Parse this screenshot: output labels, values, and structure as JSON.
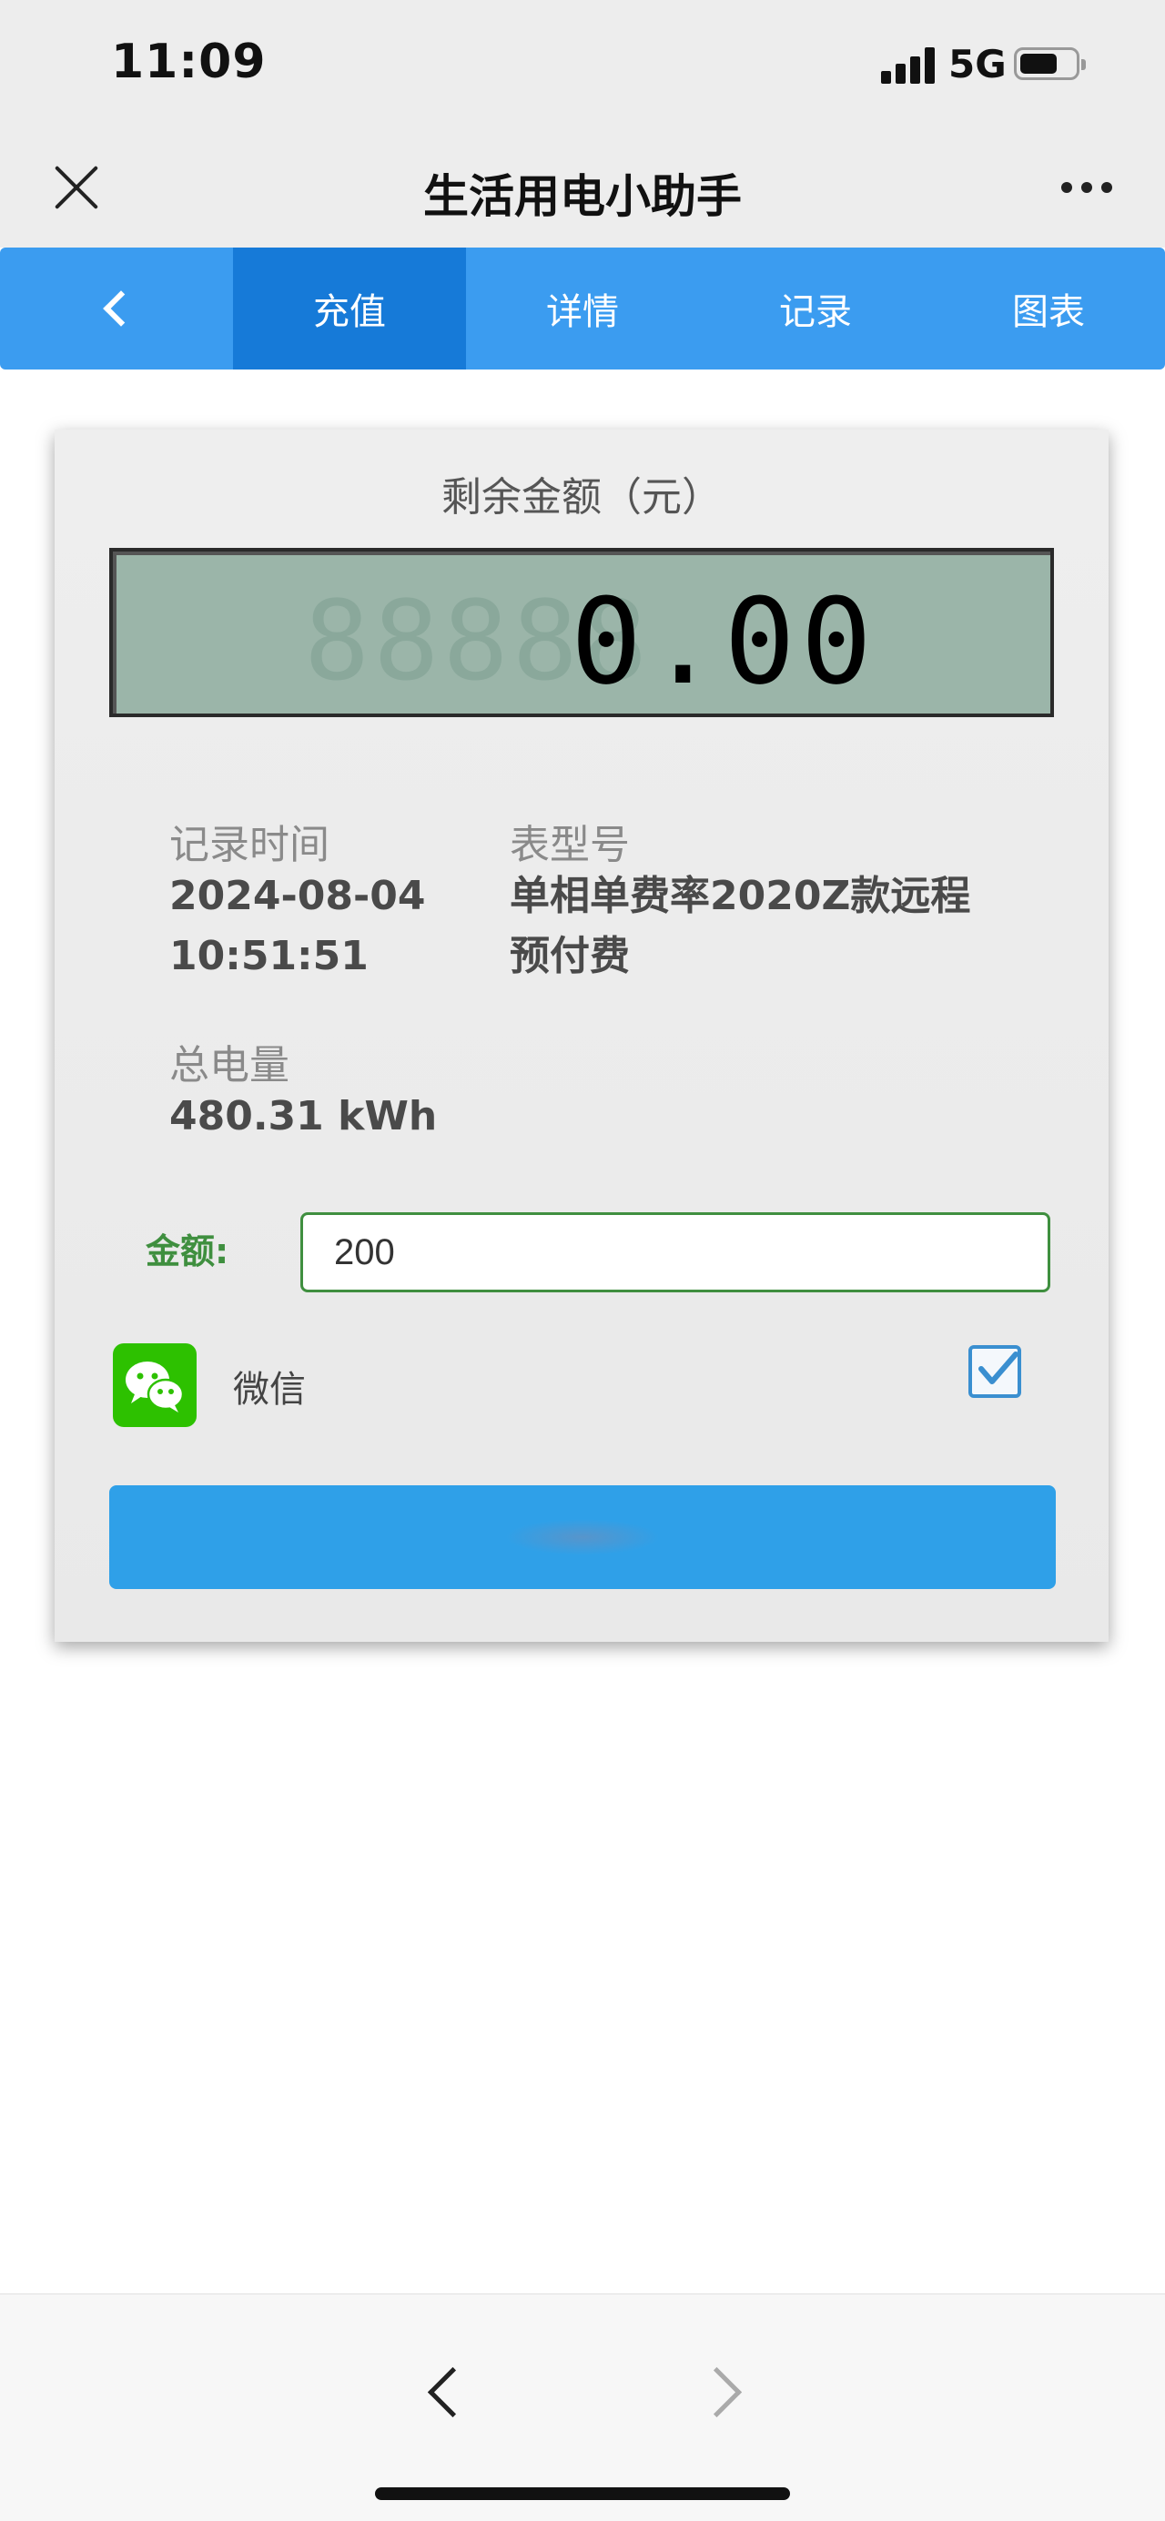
{
  "status_bar": {
    "time": "11:09",
    "network": "5G"
  },
  "nav": {
    "title": "生活用电小助手"
  },
  "tabs": [
    {
      "label": "充值",
      "active": true
    },
    {
      "label": "详情",
      "active": false
    },
    {
      "label": "记录",
      "active": false
    },
    {
      "label": "图表",
      "active": false
    }
  ],
  "card": {
    "title": "剩余金额（元）",
    "balance": "0.00",
    "lcd_ghost": "88888",
    "record_time_label": "记录时间",
    "record_date": "2024-08-04",
    "record_clock": "10:51:51",
    "meter_model_label": "表型号",
    "meter_model_line1": "单相单费率2020Z款远程",
    "meter_model_line2": "预付费",
    "total_energy_label": "总电量",
    "total_energy_value": "480.31 kWh",
    "amount_label": "金额:",
    "amount_value": "200",
    "payment_method": "微信",
    "payment_selected": true
  },
  "colors": {
    "tab_bar": "#3b9cf0",
    "tab_active": "#167ad8",
    "accent_green": "#3f8f3f",
    "wechat_green": "#2dc100",
    "pay_button": "#2fa0e8",
    "lcd_background": "#9bb5a9"
  },
  "icons": [
    "close-icon",
    "more-icon",
    "back-chevron-icon",
    "wechat-icon",
    "checkbox-checked-icon",
    "browser-back-icon",
    "browser-forward-icon"
  ]
}
